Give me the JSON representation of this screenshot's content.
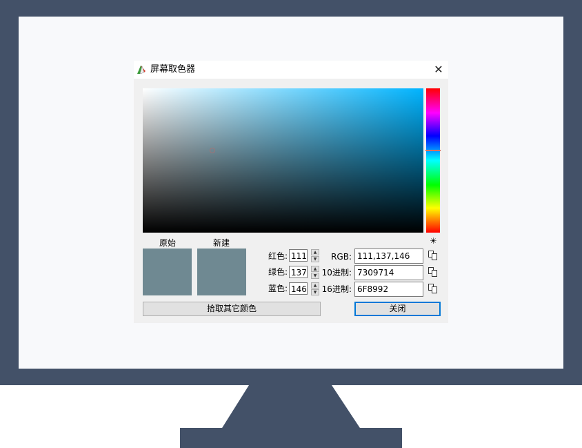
{
  "dialog": {
    "title": "屏幕取色器",
    "close_glyph": "✕"
  },
  "swatches": {
    "original_label": "原始",
    "new_label": "新建",
    "original_color": "#6f8992",
    "new_color": "#6f8992"
  },
  "rgb_fields": {
    "red_label": "红色:",
    "red_value": "111",
    "green_label": "绿色:",
    "green_value": "137",
    "blue_label": "蓝色:",
    "blue_value": "146"
  },
  "formats": {
    "rgb_label": "RGB:",
    "rgb_value": "111,137,146",
    "decimal_label": "10进制:",
    "decimal_value": "7309714",
    "hex_label": "16进制:",
    "hex_value": "6F8992"
  },
  "buttons": {
    "pick_other": "拾取其它颜色",
    "close": "关闭"
  },
  "icons": {
    "brightness": "☀",
    "app": "color-picker-icon",
    "copy": "copy-icon"
  },
  "colors": {
    "monitor": "#435168",
    "hue_base": "#00b4ff",
    "accent": "#0078d7"
  }
}
